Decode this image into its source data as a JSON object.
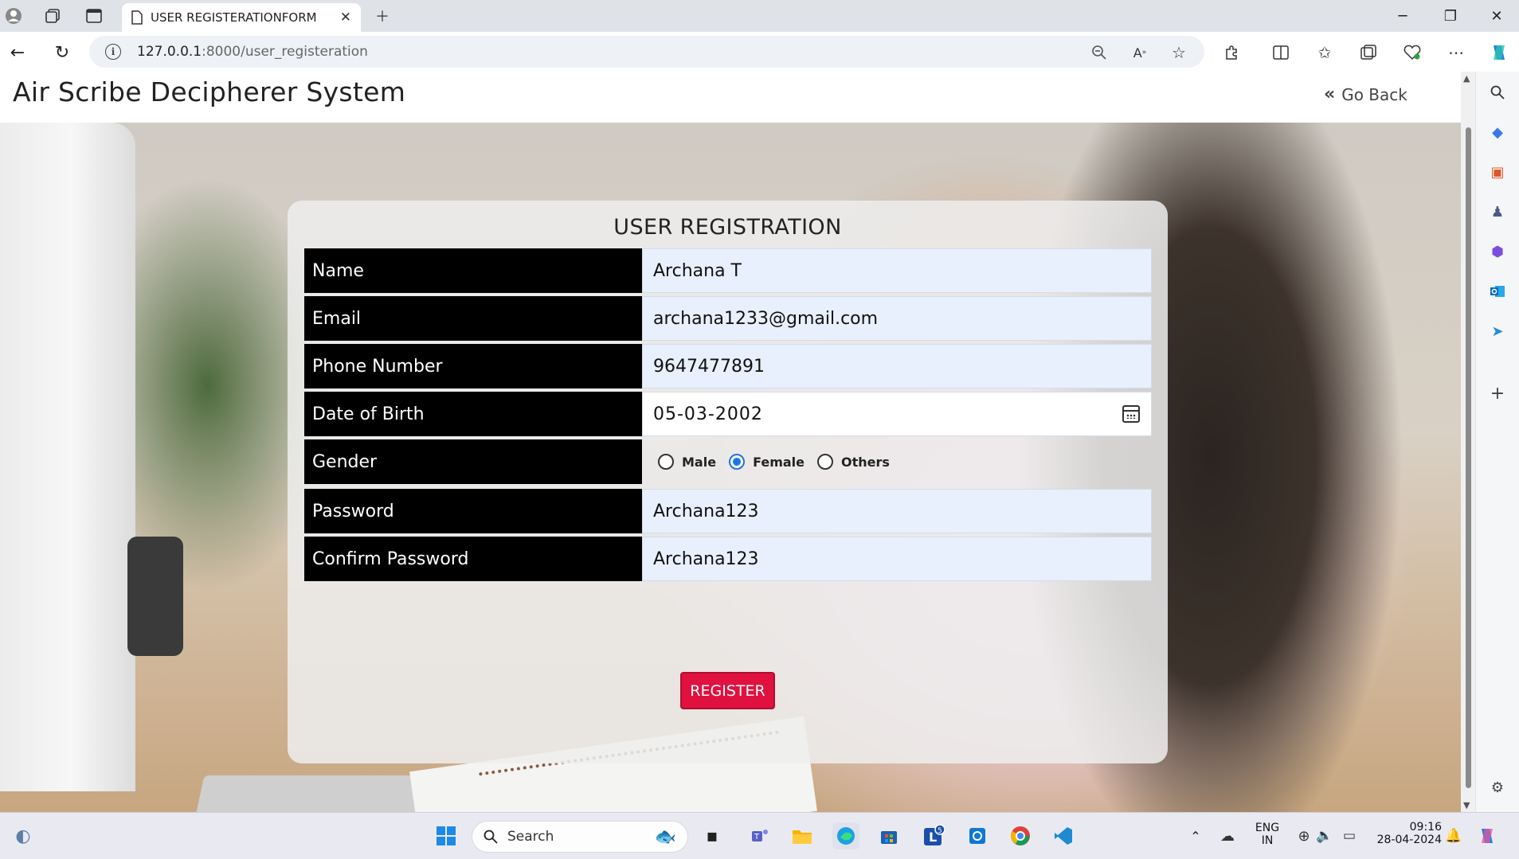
{
  "browser": {
    "tab_title": "USER REGISTERATIONFORM",
    "url_host": "127.0.0.1",
    "url_path": ":8000/user_registeration"
  },
  "site": {
    "title": "Air Scribe Decipherer System",
    "go_back": "Go Back"
  },
  "form": {
    "heading": "USER REGISTRATION",
    "fields": [
      {
        "label": "Name",
        "value": "Archana T"
      },
      {
        "label": "Email",
        "value": "archana1233@gmail.com"
      },
      {
        "label": "Phone Number",
        "value": "9647477891"
      },
      {
        "label": "Date of Birth",
        "value": "05-03-2002"
      },
      {
        "label": "Gender",
        "value": ""
      },
      {
        "label": "Password",
        "value": "Archana123"
      },
      {
        "label": "Confirm Password",
        "value": "Archana123"
      }
    ],
    "gender_options": [
      {
        "label": "Male",
        "selected": false
      },
      {
        "label": "Female",
        "selected": true
      },
      {
        "label": "Others",
        "selected": false
      }
    ],
    "register_label": "REGISTER"
  },
  "taskbar": {
    "search_label": "Search",
    "lang_line1": "ENG",
    "lang_line2": "IN",
    "time": "09:16",
    "date": "28-04-2024",
    "badge_count": "5"
  },
  "colors": {
    "label_bg": "#000000",
    "input_bg": "#e8f0fe",
    "register_bg": "#e0113f",
    "radio_accent": "#1a73e8"
  }
}
